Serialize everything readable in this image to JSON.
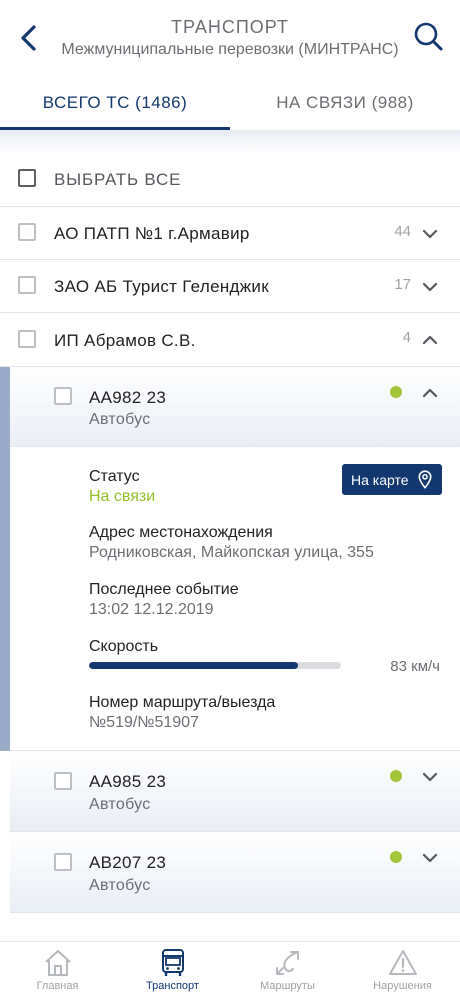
{
  "header": {
    "title": "ТРАНСПОРТ",
    "subtitle": "Межмуниципальные перевозки (МИНТРАНС)"
  },
  "tabs": [
    {
      "label": "ВСЕГО ТС (1486)",
      "active": true
    },
    {
      "label": "НА СВЯЗИ (988)",
      "active": false
    }
  ],
  "select_all": {
    "label": "ВЫБРАТЬ ВСЕ"
  },
  "groups": [
    {
      "name": "АО ПАТП №1 г.Армавир",
      "count": "44",
      "expanded": false
    },
    {
      "name": "ЗАО АБ Турист Геленджик",
      "count": "17",
      "expanded": false
    },
    {
      "name": "ИП Абрамов С.В.",
      "count": "4",
      "expanded": true
    }
  ],
  "vehicles": [
    {
      "plate": "АА982 23",
      "type": "Автобус",
      "online": true,
      "expanded": true
    },
    {
      "plate": "АА985 23",
      "type": "Автобус",
      "online": true,
      "expanded": false
    },
    {
      "plate": "АВ207 23",
      "type": "Автобус",
      "online": true,
      "expanded": false
    }
  ],
  "detail": {
    "status_label": "Статус",
    "status_value": "На связи",
    "map_button": "На карте",
    "address_label": "Адрес местонахождения",
    "address_value": "Родниковская, Майкопская улица, 355",
    "event_label": "Последнее событие",
    "event_value": "13:02 12.12.2019",
    "speed_label": "Скорость",
    "speed_value": "83 км/ч",
    "speed_fraction": 0.83,
    "route_label": "Номер маршрута/выезда",
    "route_value": "№519/№51907"
  },
  "bottom_nav": [
    {
      "label": "Главная",
      "icon": "home-icon",
      "active": false
    },
    {
      "label": "Транспорт",
      "icon": "bus-icon",
      "active": true
    },
    {
      "label": "Маршруты",
      "icon": "routes-icon",
      "active": false
    },
    {
      "label": "Нарушения",
      "icon": "warning-icon",
      "active": false
    }
  ],
  "colors": {
    "accent": "#12386f",
    "online": "#a2c539",
    "status_online_text": "#93bf2b",
    "muted": "#6b6e73"
  }
}
